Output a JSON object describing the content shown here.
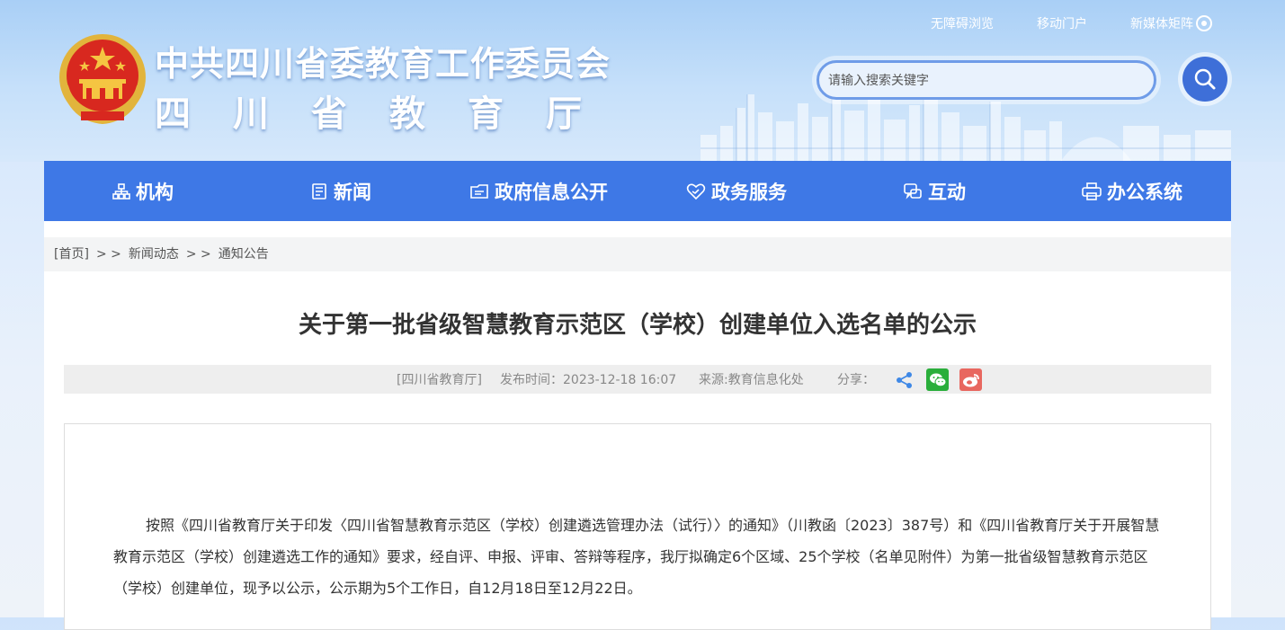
{
  "header": {
    "org_title": "中共四川省委教育工作委员会",
    "org_subtitle": "四川省教育厅",
    "toplinks": {
      "accessible": "无障碍浏览",
      "mobile": "移动门户",
      "media": "新媒体矩阵"
    },
    "search_placeholder": "请输入搜索关键字"
  },
  "nav": [
    {
      "label": "机构",
      "icon": "org-chart-icon"
    },
    {
      "label": "新闻",
      "icon": "news-icon"
    },
    {
      "label": "政府信息公开",
      "icon": "folder-icon"
    },
    {
      "label": "政务服务",
      "icon": "heart-hand-icon"
    },
    {
      "label": "互动",
      "icon": "chat-icon"
    },
    {
      "label": "办公系统",
      "icon": "printer-icon"
    }
  ],
  "breadcrumb": {
    "home": "[首页]",
    "sep": "> >",
    "news": "新闻动态",
    "notice": "通知公告"
  },
  "article": {
    "title": "关于第一批省级智慧教育示范区（学校）创建单位入选名单的公示",
    "source_org": "[四川省教育厅]",
    "publish_time": "发布时间：2023-12-18 16:07",
    "source": "来源:教育信息化处",
    "share_label": "分享：",
    "body": "按照《四川省教育厅关于印发〈四川省智慧教育示范区（学校）创建遴选管理办法（试行）〉的通知》（川教函〔2023〕387号）和《四川省教育厅关于开展智慧教育示范区（学校）创建遴选工作的通知》要求，经自评、申报、评审、答辩等程序，我厅拟确定6个区域、25个学校（名单见附件）为第一批省级智慧教育示范区（学校）创建单位，现予以公示，公示期为5个工作日，自12月18日至12月22日。"
  },
  "colors": {
    "nav_blue": "#3e78e6",
    "search_blue": "#3e6fd8",
    "wechat_green": "#2aae3b",
    "weibo_red": "#e8675f",
    "share_blue": "#3e88e6"
  }
}
